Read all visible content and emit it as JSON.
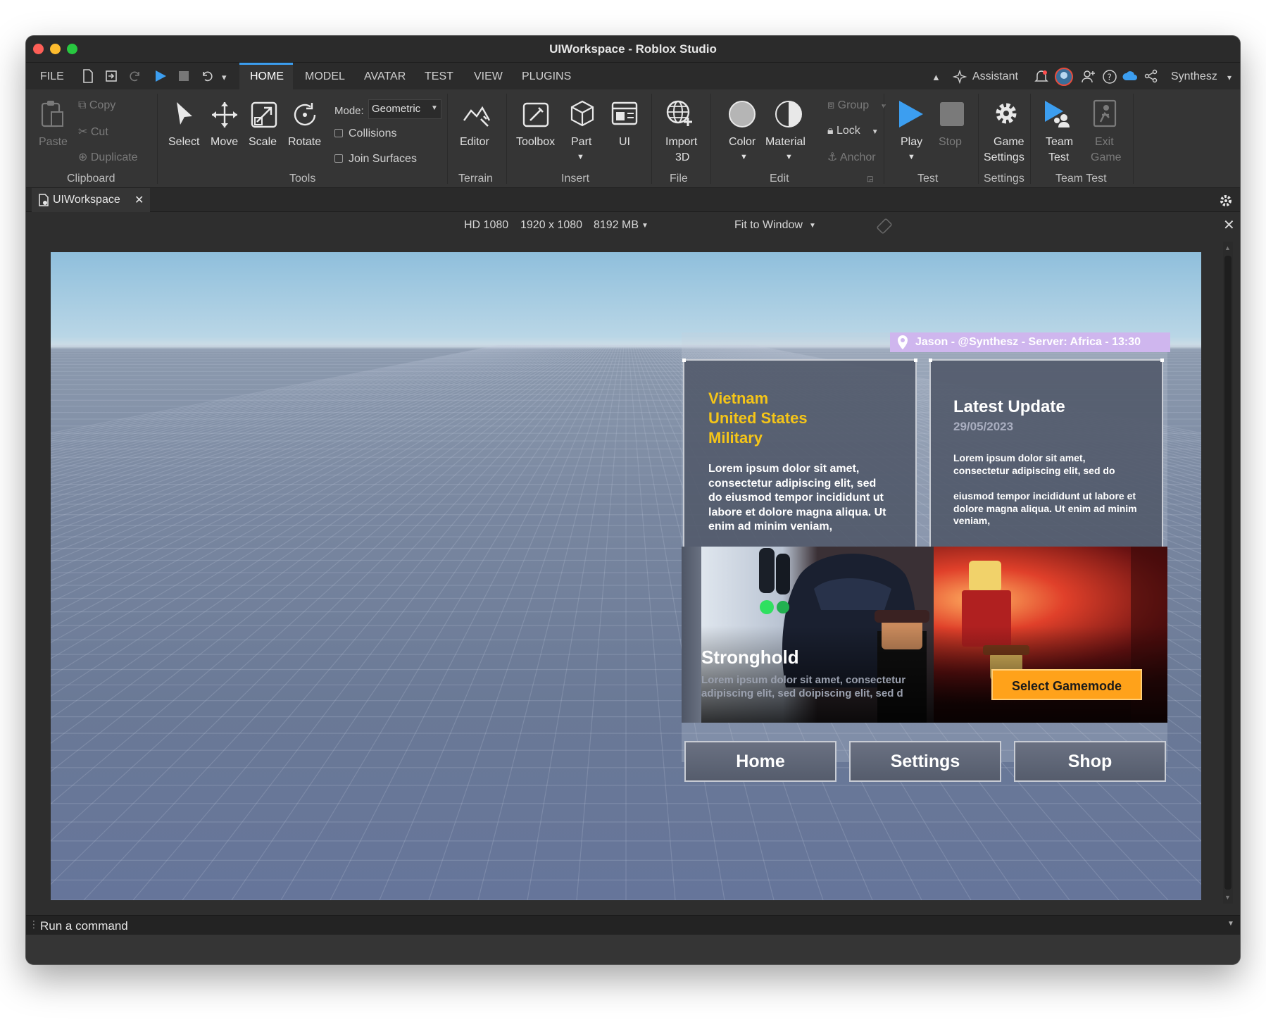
{
  "window": {
    "title": "UIWorkspace - Roblox Studio"
  },
  "menubar": {
    "file": "FILE",
    "tabs": [
      "HOME",
      "MODEL",
      "AVATAR",
      "TEST",
      "VIEW",
      "PLUGINS"
    ],
    "assistant": "Assistant",
    "user": "Synthesz"
  },
  "ribbon": {
    "clipboard": {
      "paste": "Paste",
      "copy": "Copy",
      "cut": "Cut",
      "duplicate": "Duplicate",
      "group_label": "Clipboard"
    },
    "tools": {
      "select": "Select",
      "move": "Move",
      "scale": "Scale",
      "rotate": "Rotate",
      "mode_label": "Mode:",
      "mode_value": "Geometric",
      "collisions": "Collisions",
      "join_surfaces": "Join Surfaces",
      "group_label": "Tools"
    },
    "terrain": {
      "editor": "Editor",
      "group_label": "Terrain"
    },
    "insert": {
      "toolbox": "Toolbox",
      "part": "Part",
      "ui": "UI",
      "group_label": "Insert"
    },
    "file": {
      "import_line1": "Import",
      "import_line2": "3D",
      "group_label": "File"
    },
    "edit": {
      "color": "Color",
      "material": "Material",
      "group": "Group",
      "lock": "Lock",
      "anchor": "Anchor",
      "group_label": "Edit"
    },
    "test": {
      "play": "Play",
      "stop": "Stop",
      "group_label": "Test"
    },
    "settings": {
      "line1": "Game",
      "line2": "Settings",
      "group_label": "Settings"
    },
    "team_test": {
      "team_line1": "Team",
      "team_line2": "Test",
      "exit_line1": "Exit",
      "exit_line2": "Game",
      "group_label": "Team Test"
    }
  },
  "doc_tab": {
    "label": "UIWorkspace"
  },
  "viewport_toolbar": {
    "device": "HD 1080",
    "resolution": "1920 x 1080",
    "memory": "8192 MB",
    "fit": "Fit to Window"
  },
  "game_ui": {
    "user_banner": "Jason - @Synthesz - Server: Africa - 13:30",
    "left_panel": {
      "title_lines": "Vietnam\nUnited States\nMilitary",
      "body": "Lorem ipsum dolor sit amet,\nconsectetur adipiscing elit, sed\ndo eiusmod tempor incididunt ut\nlabore et dolore magna aliqua. Ut\nenim ad minim veniam,"
    },
    "right_panel": {
      "title": "Latest Update",
      "date": "29/05/2023",
      "body1": "Lorem ipsum dolor sit amet,\nconsectetur adipiscing elit, sed do",
      "body2": "eiusmod tempor incididunt ut labore et\ndolore magna aliqua. Ut enim ad minim\nveniam,"
    },
    "banner": {
      "title": "Stronghold",
      "desc": "Lorem ipsum dolor sit amet, consectetur\nadipiscing elit, sed doipiscing elit, sed d",
      "button": "Select Gamemode"
    },
    "nav": [
      "Home",
      "Settings",
      "Shop"
    ]
  },
  "command_bar": {
    "placeholder": "Run a command"
  },
  "colors": {
    "accent": "#3c9ef0",
    "gamemode_button": "#ffa21a",
    "panel_title": "#f5c518",
    "user_banner": "#cfb6ee"
  }
}
